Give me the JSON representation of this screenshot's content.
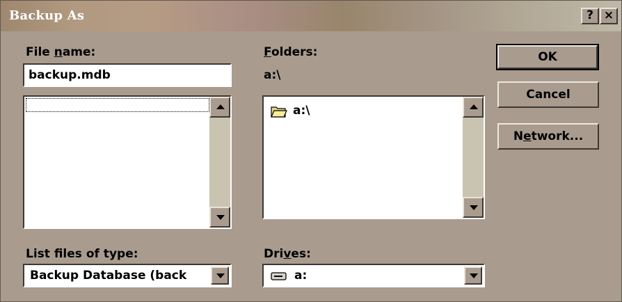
{
  "window": {
    "title": "Backup As",
    "help_glyph": "?",
    "close_glyph": "×"
  },
  "file_name": {
    "label_prefix": "File ",
    "label_accel": "n",
    "label_rest": "ame:",
    "value": "backup.mdb",
    "list_items": []
  },
  "folders": {
    "label_accel": "F",
    "label_rest": "olders:",
    "current_path": "a:\\",
    "items": [
      {
        "icon": "open-folder-icon",
        "label": "a:\\"
      }
    ]
  },
  "file_type": {
    "label": "List files of type:",
    "selected": "Backup Database (back"
  },
  "drives": {
    "label_prefix": "Dri",
    "label_accel": "v",
    "label_rest": "es:",
    "selected": "a:",
    "icon": "floppy-drive-icon"
  },
  "buttons": {
    "ok": "OK",
    "cancel": "Cancel",
    "network_prefix": "N",
    "network_accel": "e",
    "network_rest": "twork..."
  },
  "colors": {
    "dialog_bg": "#a99c8f",
    "scroll_track": "#c8c4b0"
  }
}
